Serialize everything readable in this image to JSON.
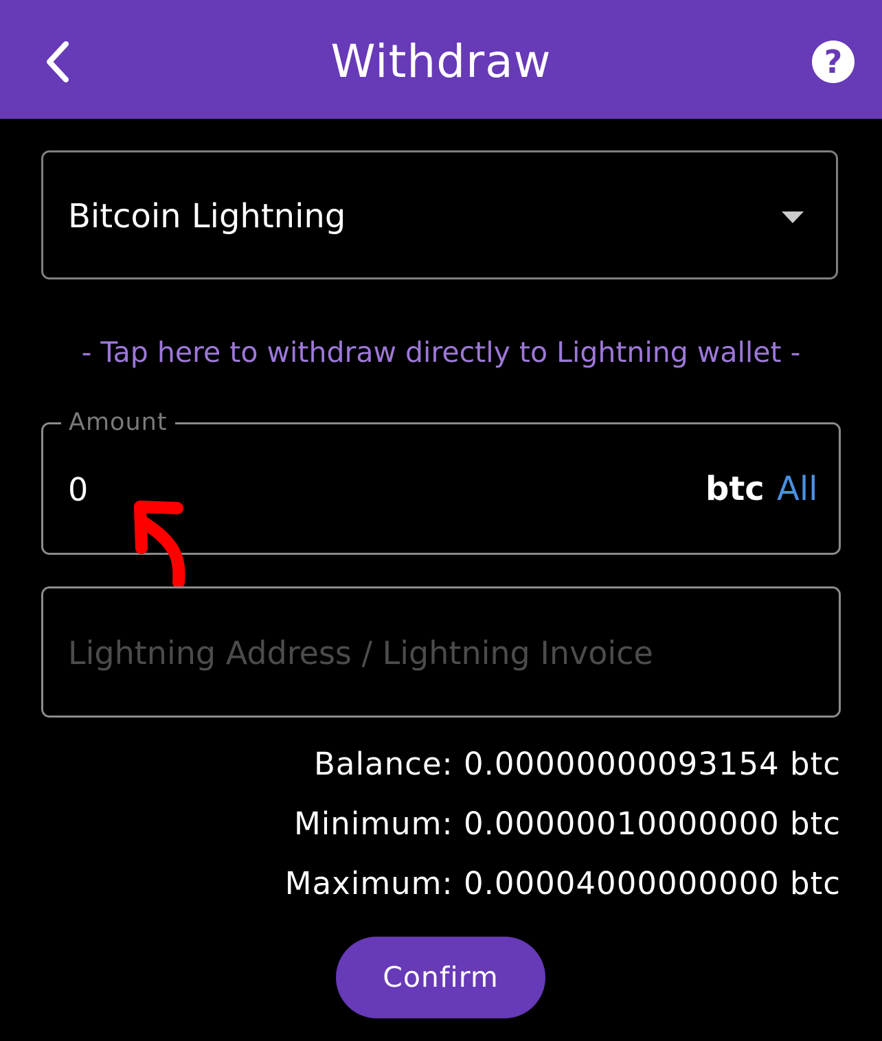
{
  "header": {
    "title": "Withdraw",
    "back_icon": "chevron-left-icon",
    "help_icon": "help-circle-icon",
    "help_glyph": "?",
    "background_color": "#673ab7"
  },
  "network_select": {
    "selected_value": "Bitcoin Lightning",
    "arrow_icon": "caret-down-icon"
  },
  "lightning_link": {
    "text": "- Tap here to withdraw directly to Lightning wallet -",
    "color": "#9d78d8"
  },
  "amount": {
    "label": "Amount",
    "value": "0",
    "unit": "btc",
    "all_label": "All",
    "all_color": "#4a90e2"
  },
  "address": {
    "placeholder": "Lightning Address / Lightning Invoice",
    "value": ""
  },
  "limits": {
    "balance": "Balance: 0.00000000093154 btc",
    "minimum": "Minimum: 0.00000010000000 btc",
    "maximum": "Maximum: 0.00004000000000 btc"
  },
  "annotation": {
    "icon": "red-curved-arrow-icon",
    "color": "#ff0000"
  },
  "confirm_button": {
    "label": "Confirm",
    "color": "#673ab7"
  }
}
